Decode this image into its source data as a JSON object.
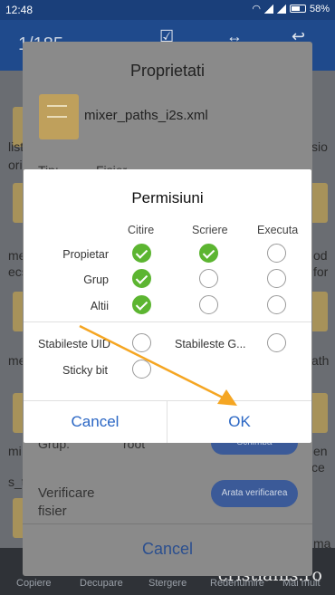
{
  "status_bar": {
    "time": "12:48",
    "battery": "58%"
  },
  "app_bar": {
    "counter": "1/185"
  },
  "background": {
    "file_labels": [
      "list",
      "ori",
      "me",
      "ecs",
      "me",
      "mi",
      "s_t",
      "sio",
      "od",
      "for",
      "ath",
      "en",
      "ce",
      "ma"
    ],
    "bottom_actions": [
      "Copiere",
      "Decupare",
      "Stergere",
      "Redenumire",
      "Mai mult"
    ]
  },
  "properties": {
    "title": "Proprietati",
    "file_name": "mixer_paths_i2s.xml",
    "type_label": "Tip:",
    "type_value": "Fisier",
    "group_label": "Grup:",
    "group_value": "root",
    "group_button": "Schimba",
    "verify_label_line1": "Verificare",
    "verify_label_line2": "fisier",
    "verify_button": "Arata verificarea",
    "cancel": "Cancel"
  },
  "permissions_dialog": {
    "title": "Permisiuni",
    "columns": [
      "Citire",
      "Scriere",
      "Executa"
    ],
    "rows": [
      {
        "label": "Propietar",
        "checks": [
          true,
          true,
          false
        ]
      },
      {
        "label": "Grup",
        "checks": [
          true,
          false,
          false
        ]
      },
      {
        "label": "Altii",
        "checks": [
          true,
          false,
          false
        ]
      }
    ],
    "options": [
      {
        "label": "Stabileste UID",
        "checked": false
      },
      {
        "label": "Stabileste G...",
        "checked": false
      },
      {
        "label": "Sticky bit",
        "checked": false
      }
    ],
    "cancel": "Cancel",
    "ok": "OK"
  },
  "watermark": "cristianls.ro",
  "colors": {
    "accent": "#2a66c4",
    "check_on": "#5cb531",
    "arrow": "#f5a623",
    "app_bar": "#1f4a8c"
  }
}
